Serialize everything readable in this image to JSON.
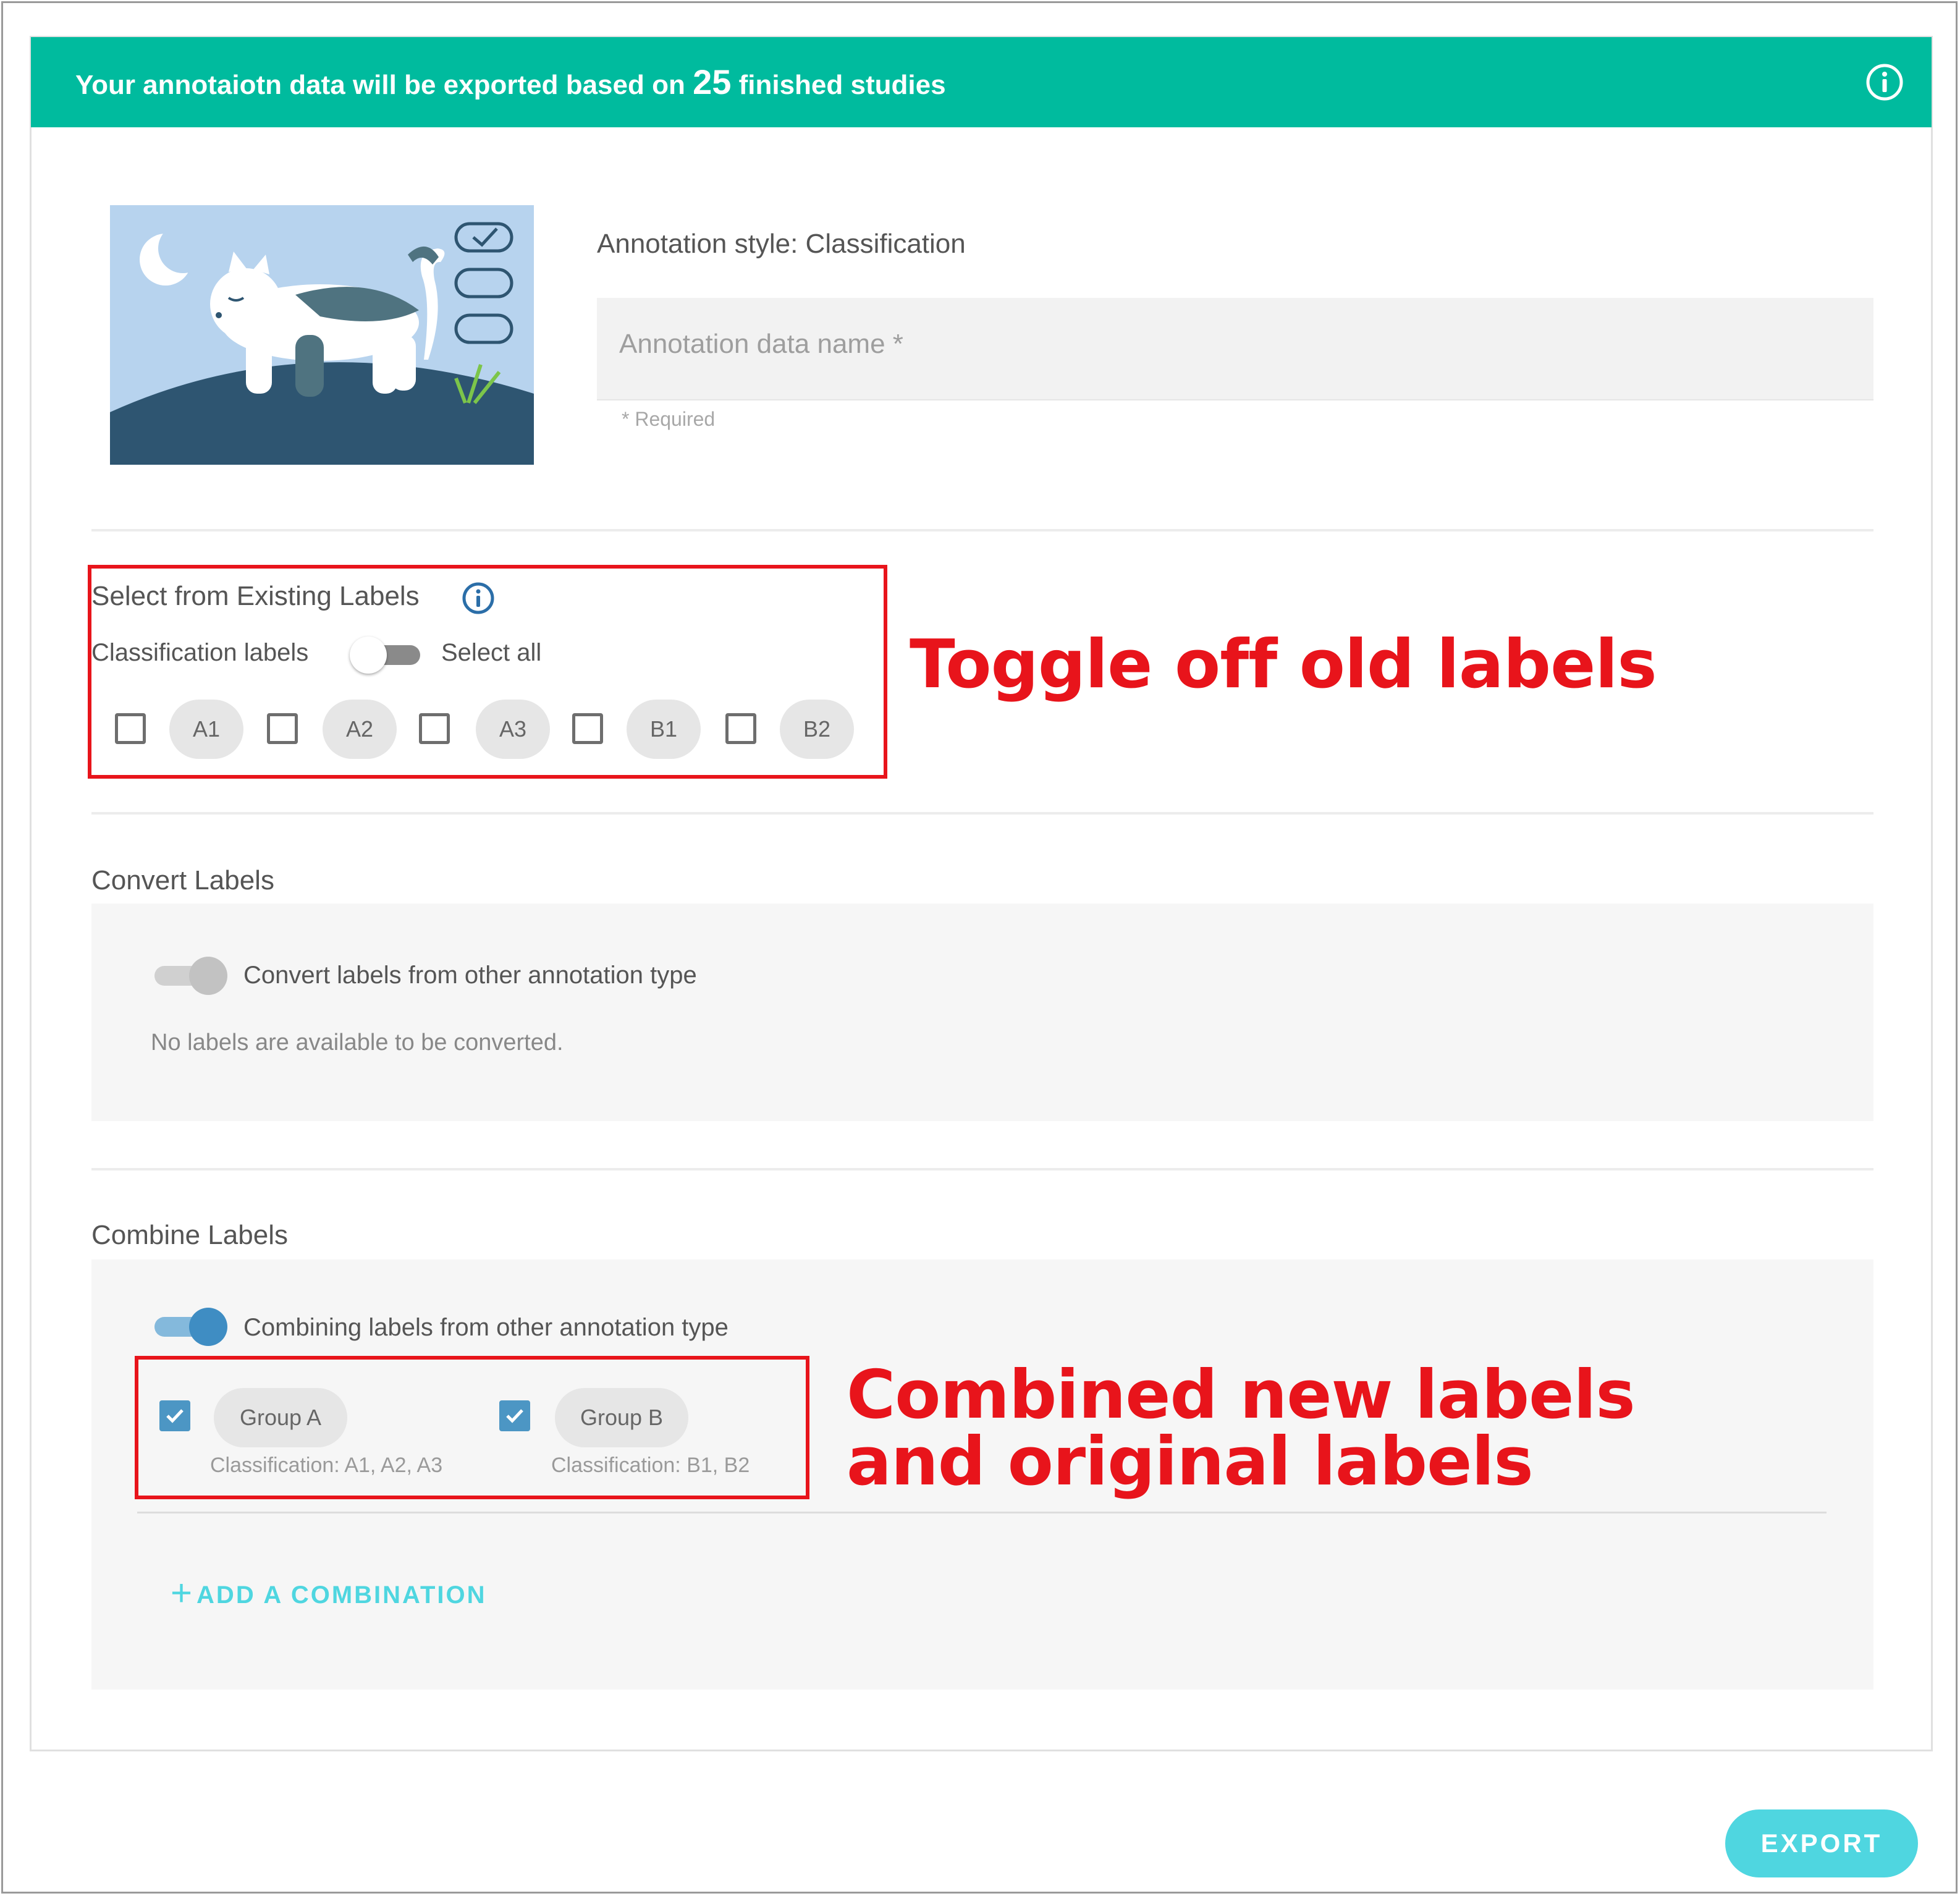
{
  "banner": {
    "text_before": "Your annotaiotn data will be exported based on",
    "count": "25",
    "text_after": "finished studies",
    "icon": "info-icon"
  },
  "annotation": {
    "style_label": "Annotation style: Classification",
    "name_placeholder": "Annotation data name *",
    "required_note": "* Required"
  },
  "existing_labels": {
    "title": "Select from Existing Labels",
    "info_icon": "info-icon",
    "classification_label": "Classification labels",
    "select_all": "Select all",
    "select_all_on": false,
    "labels": [
      "A1",
      "A2",
      "A3",
      "B1",
      "B2"
    ]
  },
  "convert_labels": {
    "title": "Convert Labels",
    "toggle_label": "Convert labels from other annotation type",
    "toggle_on": false,
    "empty_message": "No labels are available to be converted."
  },
  "combine_labels": {
    "title": "Combine Labels",
    "toggle_label": "Combining labels from other annotation type",
    "toggle_on": true,
    "groups": [
      {
        "name": "Group A",
        "detail": "Classification: A1, A2, A3",
        "checked": true
      },
      {
        "name": "Group B",
        "detail": "Classification: B1, B2",
        "checked": true
      }
    ],
    "add_button": "ADD A COMBINATION"
  },
  "actions": {
    "export_button": "EXPORT"
  },
  "annotations": {
    "toggle_note": "Toggle off old labels",
    "combined_note_line1": "Combined new labels",
    "combined_note_line2": "and original labels"
  },
  "colors": {
    "banner": "#00bb9e",
    "accent": "#4fd6e0",
    "toggle_on": "#4c96c4",
    "annotation_red": "#e8141b"
  }
}
